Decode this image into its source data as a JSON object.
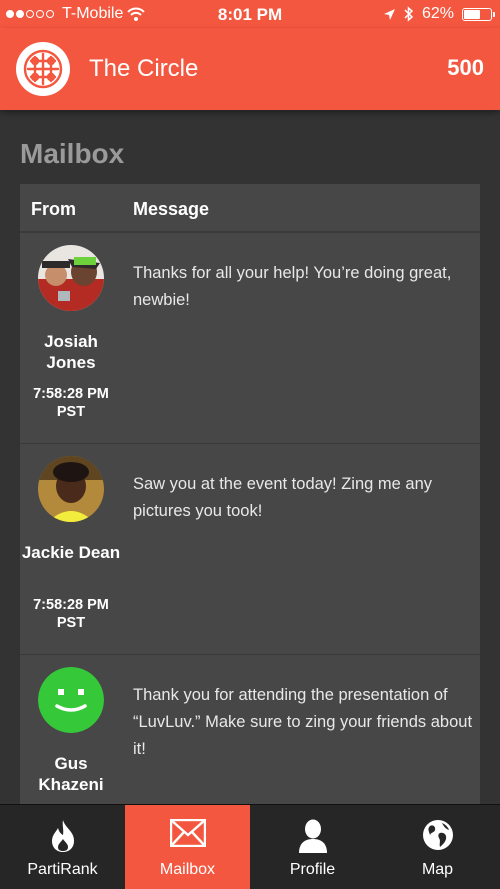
{
  "status_bar": {
    "carrier": "T-Mobile",
    "time": "8:01 PM",
    "battery": "62%",
    "battery_level": 0.62
  },
  "header": {
    "app_name": "The Circle",
    "points": "500"
  },
  "mailbox": {
    "title": "Mailbox",
    "columns": {
      "from": "From",
      "message": "Message"
    },
    "messages": [
      {
        "sender": "Josiah Jones",
        "time": "7:58:28 PM PST",
        "text": "Thanks for all your help! You’re doing great, newbie!"
      },
      {
        "sender": "Jackie Dean",
        "time": "7:58:28 PM PST",
        "text": "Saw you at the event today! Zing me any pictures you took!"
      },
      {
        "sender": "Gus Khazeni",
        "time": "",
        "text": "Thank you for attending the presentation of “LuvLuv.” Make sure to zing your friends about it!"
      }
    ]
  },
  "tabs": [
    {
      "label": "PartiRank",
      "icon": "flame-icon"
    },
    {
      "label": "Mailbox",
      "icon": "envelope-icon",
      "active": true
    },
    {
      "label": "Profile",
      "icon": "person-icon"
    },
    {
      "label": "Map",
      "icon": "globe-icon"
    }
  ],
  "colors": {
    "accent": "#f4573f",
    "background": "#333333",
    "panel": "#474747",
    "smiley_green": "#35c93a"
  }
}
